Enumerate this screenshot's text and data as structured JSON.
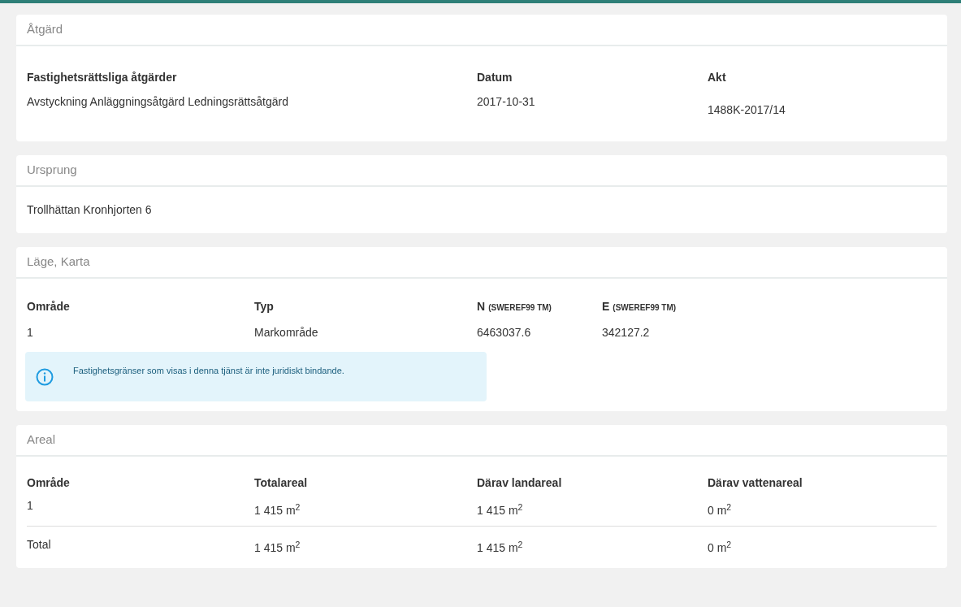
{
  "sections": [
    {
      "kind": "actions",
      "title": "Åtgärd",
      "columns": [
        "Fastighetsrättsliga åtgärder",
        "Datum",
        "Akt"
      ],
      "values": [
        "Avstyckning Anläggningsåtgärd Ledningsrättsåtgärd",
        "2017-10-31",
        "1488K-2017/14"
      ]
    },
    {
      "kind": "text",
      "title": "Ursprung",
      "text": "Trollhättan Kronhjorten 6"
    },
    {
      "kind": "location",
      "title": "Läge, Karta",
      "columns": [
        {
          "label": "Område"
        },
        {
          "label": "Typ"
        },
        {
          "label": "N",
          "unit": "(SWEREF99 TM)"
        },
        {
          "label": "E",
          "unit": "(SWEREF99 TM)"
        }
      ],
      "rows": [
        [
          "1",
          "Markområde",
          "6463037.6",
          "342127.2"
        ]
      ],
      "notice": "Fastighetsgränser som visas i denna tjänst är inte juridiskt bindande."
    },
    {
      "kind": "area",
      "title": "Areal",
      "columns": [
        "Område",
        "Totalareal",
        "Därav landareal",
        "Därav vattenareal"
      ],
      "rows": [
        [
          "1",
          "1 415 m$^{2}$",
          "1 415 m$^{2}$",
          "0 m$^{2}$"
        ]
      ],
      "total": [
        "Total",
        "1 415 m$^{2}$",
        "1 415 m$^{2}$",
        "0 m$^{2}$"
      ]
    }
  ]
}
